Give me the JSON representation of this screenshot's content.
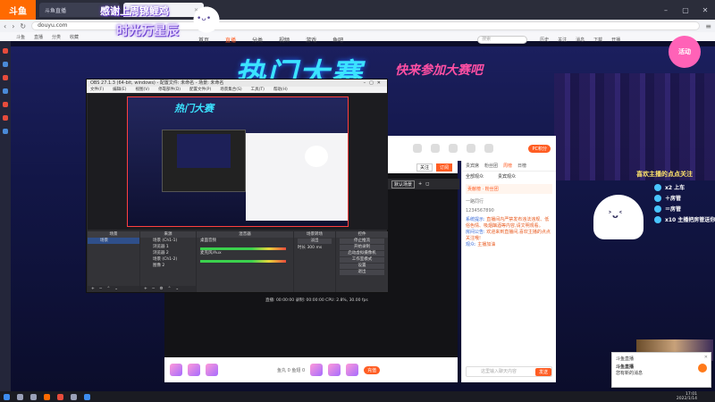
{
  "browser": {
    "logo": "斗鱼",
    "tabs": [
      {
        "label": "斗鱼直播",
        "active": false
      },
      {
        "label": "斗鱼",
        "active": true
      }
    ],
    "url": "douyu.com",
    "bookmarks": [
      "斗鱼",
      "直播",
      "分类",
      "收藏"
    ]
  },
  "overlay_text": {
    "line1": "感谢上周锦鲤鸡",
    "line2": "时光万星辰"
  },
  "site_nav": {
    "menu": [
      "首页",
      "直播",
      "分类",
      "视频",
      "游戏",
      "鱼吧"
    ],
    "current": "直播",
    "search_placeholder": "搜索",
    "icons": [
      "历史",
      "关注",
      "消息",
      "下载",
      "开播"
    ]
  },
  "hero": {
    "title": "热门大赛",
    "subtitle": "快来参加大赛吧"
  },
  "side_badge": "活动",
  "obs": {
    "title": "OBS 27.1.3 (64-bit, windows) - 配置文件: 未命名 - 场景: 未命名",
    "menu": [
      "文件(F)",
      "编辑(E)",
      "视图(V)",
      "停靠部件(D)",
      "配置文件(P)",
      "场景集合(S)",
      "工具(T)",
      "帮助(H)"
    ],
    "docks": {
      "scenes": {
        "header": "场景",
        "items": [
          "场景"
        ]
      },
      "sources": {
        "header": "来源",
        "items": [
          "场景 (Ch1-1)",
          "浏览器 1",
          "浏览器 2",
          "场景 (Ch1-2)",
          "图像 2"
        ]
      },
      "mixer": {
        "header": "混音器",
        "channels": [
          "桌面音频",
          "麦克风/Aux"
        ]
      },
      "transitions": {
        "header": "场景转场",
        "type": "淡出",
        "duration_label": "时长",
        "duration": "300 ms"
      },
      "controls": {
        "header": "控件",
        "buttons": [
          "停止推流",
          "开始录制",
          "启动虚拟摄像机",
          "工作室模式",
          "设置",
          "退出"
        ]
      }
    },
    "status": "直播: 00:00:00   录制: 00:00:00   CPU: 2.8%, 30.00 fps"
  },
  "room": {
    "header_icons": [
      "鱼丸",
      "鱼翅",
      "分享",
      "客户端",
      "举报",
      "更多"
    ],
    "points_label": "PC积分"
  },
  "player": {
    "toolbar": [
      "关注",
      "订阅"
    ],
    "scene_tag": "默认场景",
    "scene_buttons": [
      "+",
      "◻"
    ],
    "balance": "鱼丸 0  鱼翅 0",
    "recharge": "充值"
  },
  "chat": {
    "rank_tabs": [
      "贵宾席",
      "粉丝团",
      "周榜",
      "日榜"
    ],
    "current_tab": "周榜",
    "header": [
      "全部观众",
      "贵宾观众"
    ],
    "notice": "贡献榜 · 粉丝团",
    "fan_lines": [
      "一路同行",
      "1234567890"
    ],
    "messages": [
      {
        "user": "系统提示:",
        "text": "直播间内严禁发布违法违规、低俗色情、吸烟酗酒等内容,请文明观看。"
      },
      {
        "user": "房间公告:",
        "text": "欢迎来到直播间,喜欢主播的点点关注哦!"
      },
      {
        "user": "观众:",
        "text": "主播加油"
      }
    ],
    "input_placeholder": "这里输入聊天内容",
    "send": "发送"
  },
  "follow_overlay": {
    "title": "喜欢主播的点点关注",
    "lines": [
      "x2 上车",
      "＋房管",
      "＝房管",
      "x10 主播把房管送你"
    ]
  },
  "notification": {
    "app": "斗鱼直播",
    "title": "斗鱼直播",
    "body": "您有新的消息",
    "dismiss": "✕"
  },
  "taskbar": {
    "time": "17:01",
    "date": "2022/1/14"
  },
  "colors": {
    "brand": "#ff5d23",
    "bg_dark": "#0c0e2a",
    "hero_cyan": "#3be3ff"
  }
}
